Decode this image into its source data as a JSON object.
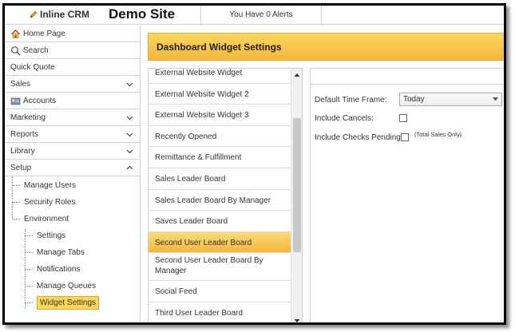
{
  "header": {
    "brand_name": "Inline CRM",
    "site_title": "Demo Site",
    "alerts_text": "You Have 0 Alerts"
  },
  "sidebar": {
    "home": "Home Page",
    "search": "Search",
    "quick_quote": "Quick Quote",
    "sales": "Sales",
    "accounts": "Accounts",
    "marketing": "Marketing",
    "reports": "Reports",
    "library": "Library",
    "setup": "Setup",
    "setup_items": {
      "manage_users": "Manage Users",
      "security_roles": "Security Roles",
      "environment": "Environment",
      "settings": "Settings",
      "manage_tabs": "Manage Tabs",
      "notifications": "Notifications",
      "manage_queues": "Manage Queues",
      "widget_settings": "Widget Settings"
    }
  },
  "main": {
    "title": "Dashboard Widget Settings",
    "widgets": [
      "External Website Widget",
      "External Website Widget 2",
      "External Website Widget 3",
      "Recently Opened",
      "Remittance & Fulfillment",
      "Sales Leader Board",
      "Sales Leader Board By Manager",
      "Saves Leader Board",
      "Second User Leader Board",
      "Second User Leader Board By Manager",
      "Social Feed",
      "Third User Leader Board"
    ],
    "selected_widget": "Second User Leader Board"
  },
  "settings": {
    "time_frame_label": "Default Time Frame:",
    "time_frame_value": "Today",
    "include_cancels_label": "Include Cancels:",
    "include_checks_label": "Include Checks Pending:",
    "total_sales_note": "(Total Sales Only)"
  },
  "colors": {
    "accent": "#f4b73a",
    "accent_light": "#fdd660",
    "border": "#d0d0d0"
  }
}
